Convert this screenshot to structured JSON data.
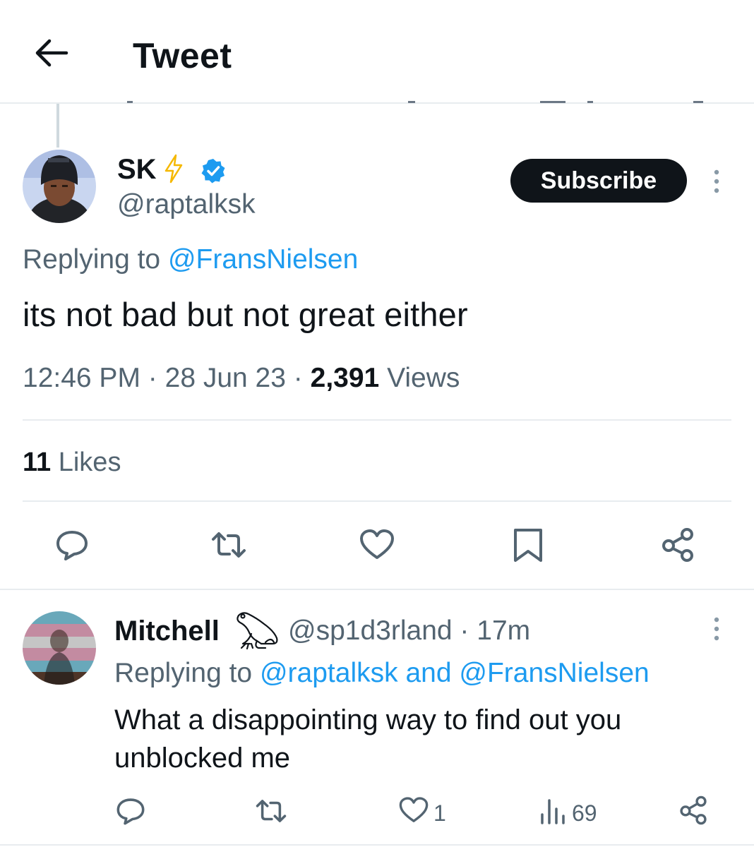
{
  "header": {
    "title": "Tweet"
  },
  "main_tweet": {
    "display_name": "SK",
    "handle": "@raptalksk",
    "subscribe_label": "Subscribe",
    "replying_prefix": "Replying to",
    "replying_to": "@FransNielsen",
    "text": "its not bad but not great either",
    "time": "12:46 PM",
    "date": "28 Jun 23",
    "views_count": "2,391",
    "views_label": "Views",
    "likes_count": "11",
    "likes_label": "Likes",
    "dot": "·"
  },
  "reply_tweet": {
    "display_name": "Mitchell",
    "handle": "@sp1d3rland",
    "age": "17m",
    "replying_prefix": "Replying to",
    "replying_to": "@raptalksk and @FransNielsen",
    "text": "What a disappointing way to find out you unblocked me",
    "like_count": "1",
    "views_count": "69",
    "dot": "·"
  },
  "colors": {
    "text": "#0f1419",
    "secondary": "#536471",
    "link": "#1d9bf0",
    "divider": "#e8ecef",
    "button_bg": "#0f1419",
    "lightning": "#f5b800"
  },
  "icons": [
    "back-arrow-icon",
    "lightning-icon",
    "verified-badge-icon",
    "more-options-icon",
    "reply-icon",
    "retweet-icon",
    "like-icon",
    "bookmark-icon",
    "share-icon",
    "frog-icon",
    "views-icon"
  ]
}
